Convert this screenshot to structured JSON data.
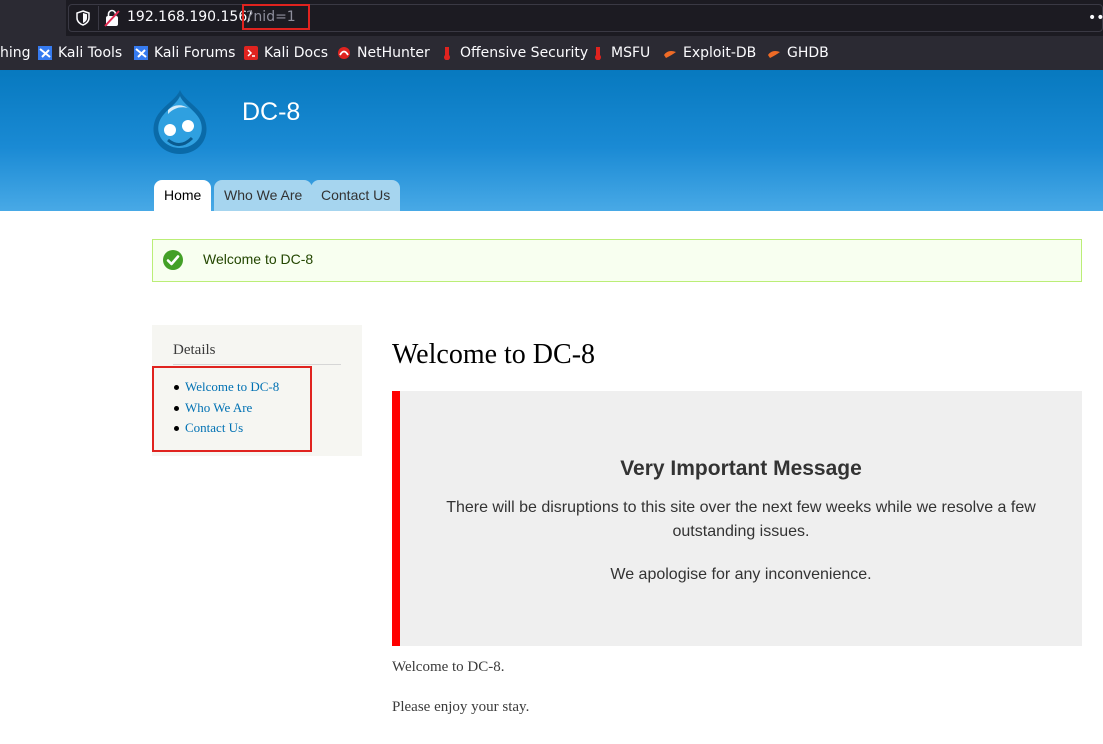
{
  "browser": {
    "url_host": "192.168.190.156/",
    "url_query": "?nid=1",
    "menu_glyph": "••",
    "bookmarks": [
      {
        "label": "hing",
        "icon": "none"
      },
      {
        "label": "Kali Tools",
        "icon": "kali-icon"
      },
      {
        "label": "Kali Forums",
        "icon": "kali-icon"
      },
      {
        "label": "Kali Docs",
        "icon": "kali-docs-icon"
      },
      {
        "label": "NetHunter",
        "icon": "nethunter-icon"
      },
      {
        "label": "Offensive Security",
        "icon": "offsec-icon"
      },
      {
        "label": "MSFU",
        "icon": "offsec-icon"
      },
      {
        "label": "Exploit-DB",
        "icon": "exploitdb-icon"
      },
      {
        "label": "GHDB",
        "icon": "exploitdb-icon"
      }
    ]
  },
  "site": {
    "name": "DC-8",
    "tabs": [
      {
        "label": "Home",
        "active": true
      },
      {
        "label": "Who We Are",
        "active": false
      },
      {
        "label": "Contact Us",
        "active": false
      }
    ]
  },
  "status": {
    "message": "Welcome to DC-8"
  },
  "sidebar": {
    "title": "Details",
    "items": [
      {
        "label": "Welcome to DC-8"
      },
      {
        "label": "Who We Are"
      },
      {
        "label": "Contact Us"
      }
    ]
  },
  "main": {
    "title": "Welcome to DC-8",
    "notice": {
      "heading": "Very Important Message",
      "line1a": "There will be disruptions to this site over the next few weeks while we resolve a few",
      "line1b": "outstanding issues.",
      "line2": "We apologise for any inconvenience."
    },
    "paragraphs": [
      "Welcome to DC-8.",
      "Please enjoy your stay."
    ]
  },
  "colors": {
    "header_top": "#0779bf",
    "header_bottom": "#48a9e6",
    "notice_accent": "#ff0000",
    "link": "#0071b3",
    "highlight_box": "#e0231f"
  }
}
